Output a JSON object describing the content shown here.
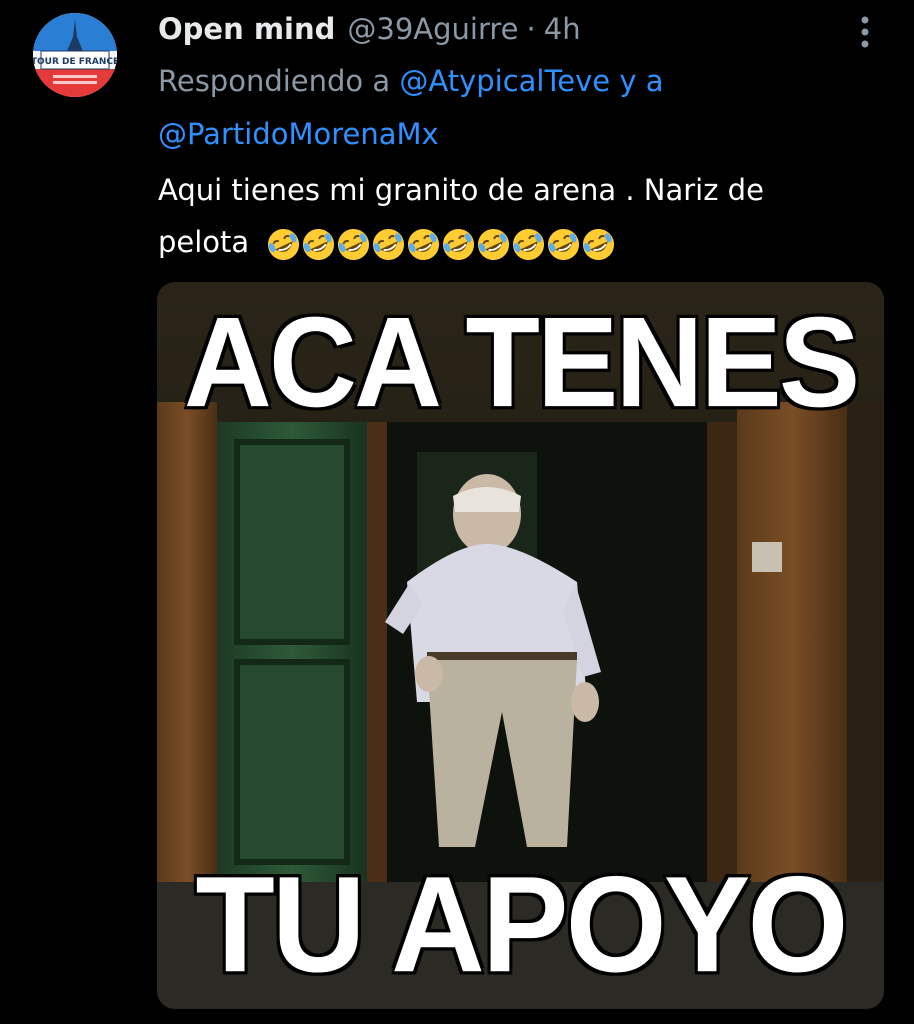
{
  "tweet": {
    "display_name": "Open mind",
    "handle": "@39Aguirre",
    "separator": "·",
    "time": "4h",
    "avatar_logo_text": "TOUR DE FRANCE",
    "reply_prefix": "Respondiendo a",
    "reply_to_1": "@AtypicalTeve",
    "reply_joiner": "y a",
    "reply_to_2": "@PartidoMorenaMx",
    "text_line_1": "Aqui tienes mi granito de arena . Nariz de",
    "text_line_2": "pelota",
    "emoji_name": "rolling-on-the-floor-laughing",
    "emoji_count": 10
  },
  "media": {
    "top_caption": "ACA TENES",
    "bottom_caption": "TU APOYO"
  },
  "colors": {
    "background": "#000000",
    "link": "#2f91ff",
    "secondary_text": "#8b98a5",
    "primary_text": "#e7e9ea"
  }
}
